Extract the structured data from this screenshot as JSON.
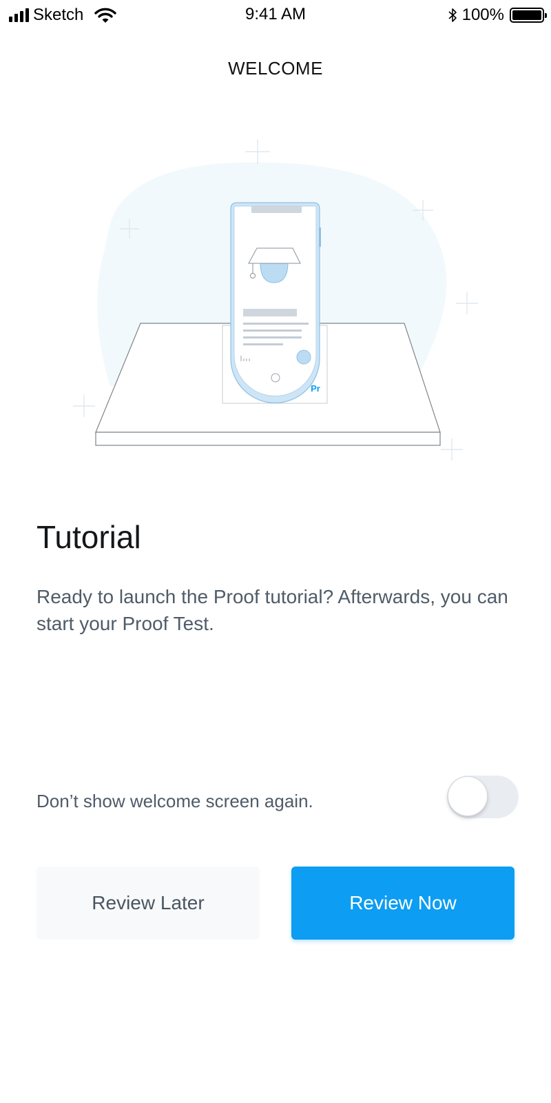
{
  "status_bar": {
    "carrier": "Sketch",
    "time": "9:41 AM",
    "battery_percent": "100%",
    "icons": [
      "signal-icon",
      "wifi-icon",
      "bluetooth-icon",
      "battery-icon"
    ]
  },
  "header": {
    "title": "WELCOME"
  },
  "illustration": {
    "badge_text": "Pr",
    "icon": "graduation-cap-icon"
  },
  "content": {
    "title": "Tutorial",
    "description": "Ready to launch the Proof tutorial? Afterwards, you can start your Proof Test."
  },
  "preference": {
    "label": "Don’t show welcome screen again.",
    "toggle_on": false
  },
  "actions": {
    "secondary_label": "Review Later",
    "primary_label": "Review Now"
  },
  "colors": {
    "accent": "#0d9df2",
    "text_muted": "#4f5b68",
    "blob": "#f2f9fc",
    "phone_blue": "#cde5f6"
  }
}
